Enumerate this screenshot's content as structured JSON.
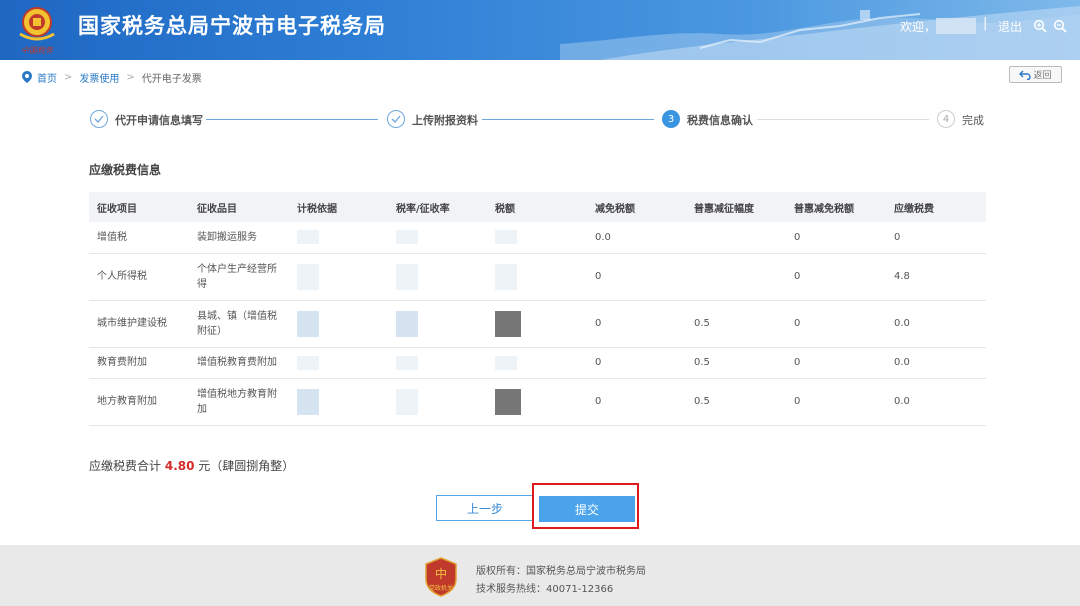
{
  "header": {
    "site_title": "国家税务总局宁波市电子税务局",
    "emblem_text": "中国税务",
    "welcome": "欢迎，",
    "separator": "|",
    "logout": "退出",
    "zoom_in_icon": "zoom-in-icon",
    "zoom_out_icon": "zoom-out-icon"
  },
  "breadcrumb": {
    "home": "首页",
    "level1": "发票使用",
    "current": "代开电子发票",
    "gt": ">"
  },
  "back_button": "返回",
  "steps": [
    {
      "label": "代开申请信息填写",
      "state": "done"
    },
    {
      "label": "上传附报资料",
      "state": "done"
    },
    {
      "num": "3",
      "label": "税费信息确认",
      "state": "active"
    },
    {
      "num": "4",
      "label": "完成",
      "state": "todo"
    }
  ],
  "section_title": "应缴税费信息",
  "table": {
    "headers": [
      "征收项目",
      "征收品目",
      "计税依据",
      "税率/征收率",
      "税额",
      "减免税额",
      "普惠减征幅度",
      "普惠减免税额",
      "应缴税费"
    ],
    "rows": [
      {
        "item": "增值税",
        "subitem": "装卸搬运服务",
        "relief": "0.0",
        "puhui_rate": "",
        "puhui_amount": "0",
        "payable": "0"
      },
      {
        "item": "个人所得税",
        "subitem": "个体户生产经营所得",
        "relief": "0",
        "puhui_rate": "",
        "puhui_amount": "0",
        "payable": "4.8"
      },
      {
        "item": "城市维护建设税",
        "subitem": "县城、镇（增值税附征）",
        "relief": "0",
        "puhui_rate": "0.5",
        "puhui_amount": "0",
        "payable": "0.0"
      },
      {
        "item": "教育费附加",
        "subitem": "增值税教育费附加",
        "relief": "0",
        "puhui_rate": "0.5",
        "puhui_amount": "0",
        "payable": "0.0"
      },
      {
        "item": "地方教育附加",
        "subitem": "增值税地方教育附加",
        "relief": "0",
        "puhui_rate": "0.5",
        "puhui_amount": "0",
        "payable": "0.0"
      }
    ]
  },
  "total": {
    "label": "应缴税费合计",
    "amount": "4.80",
    "unit": "元",
    "uppercase": "（肆圆捌角整）"
  },
  "buttons": {
    "prev": "上一步",
    "submit": "提交"
  },
  "footer": {
    "copyright": "版权所有：国家税务总局宁波市税务局",
    "hotline": "技术服务热线：40071-12366",
    "logo_text": "党政机关"
  },
  "colors": {
    "header_blue": "#2f7fd6",
    "accent_blue": "#3a95e0",
    "highlight_red": "#e0191c",
    "total_red": "#d42b2b"
  }
}
